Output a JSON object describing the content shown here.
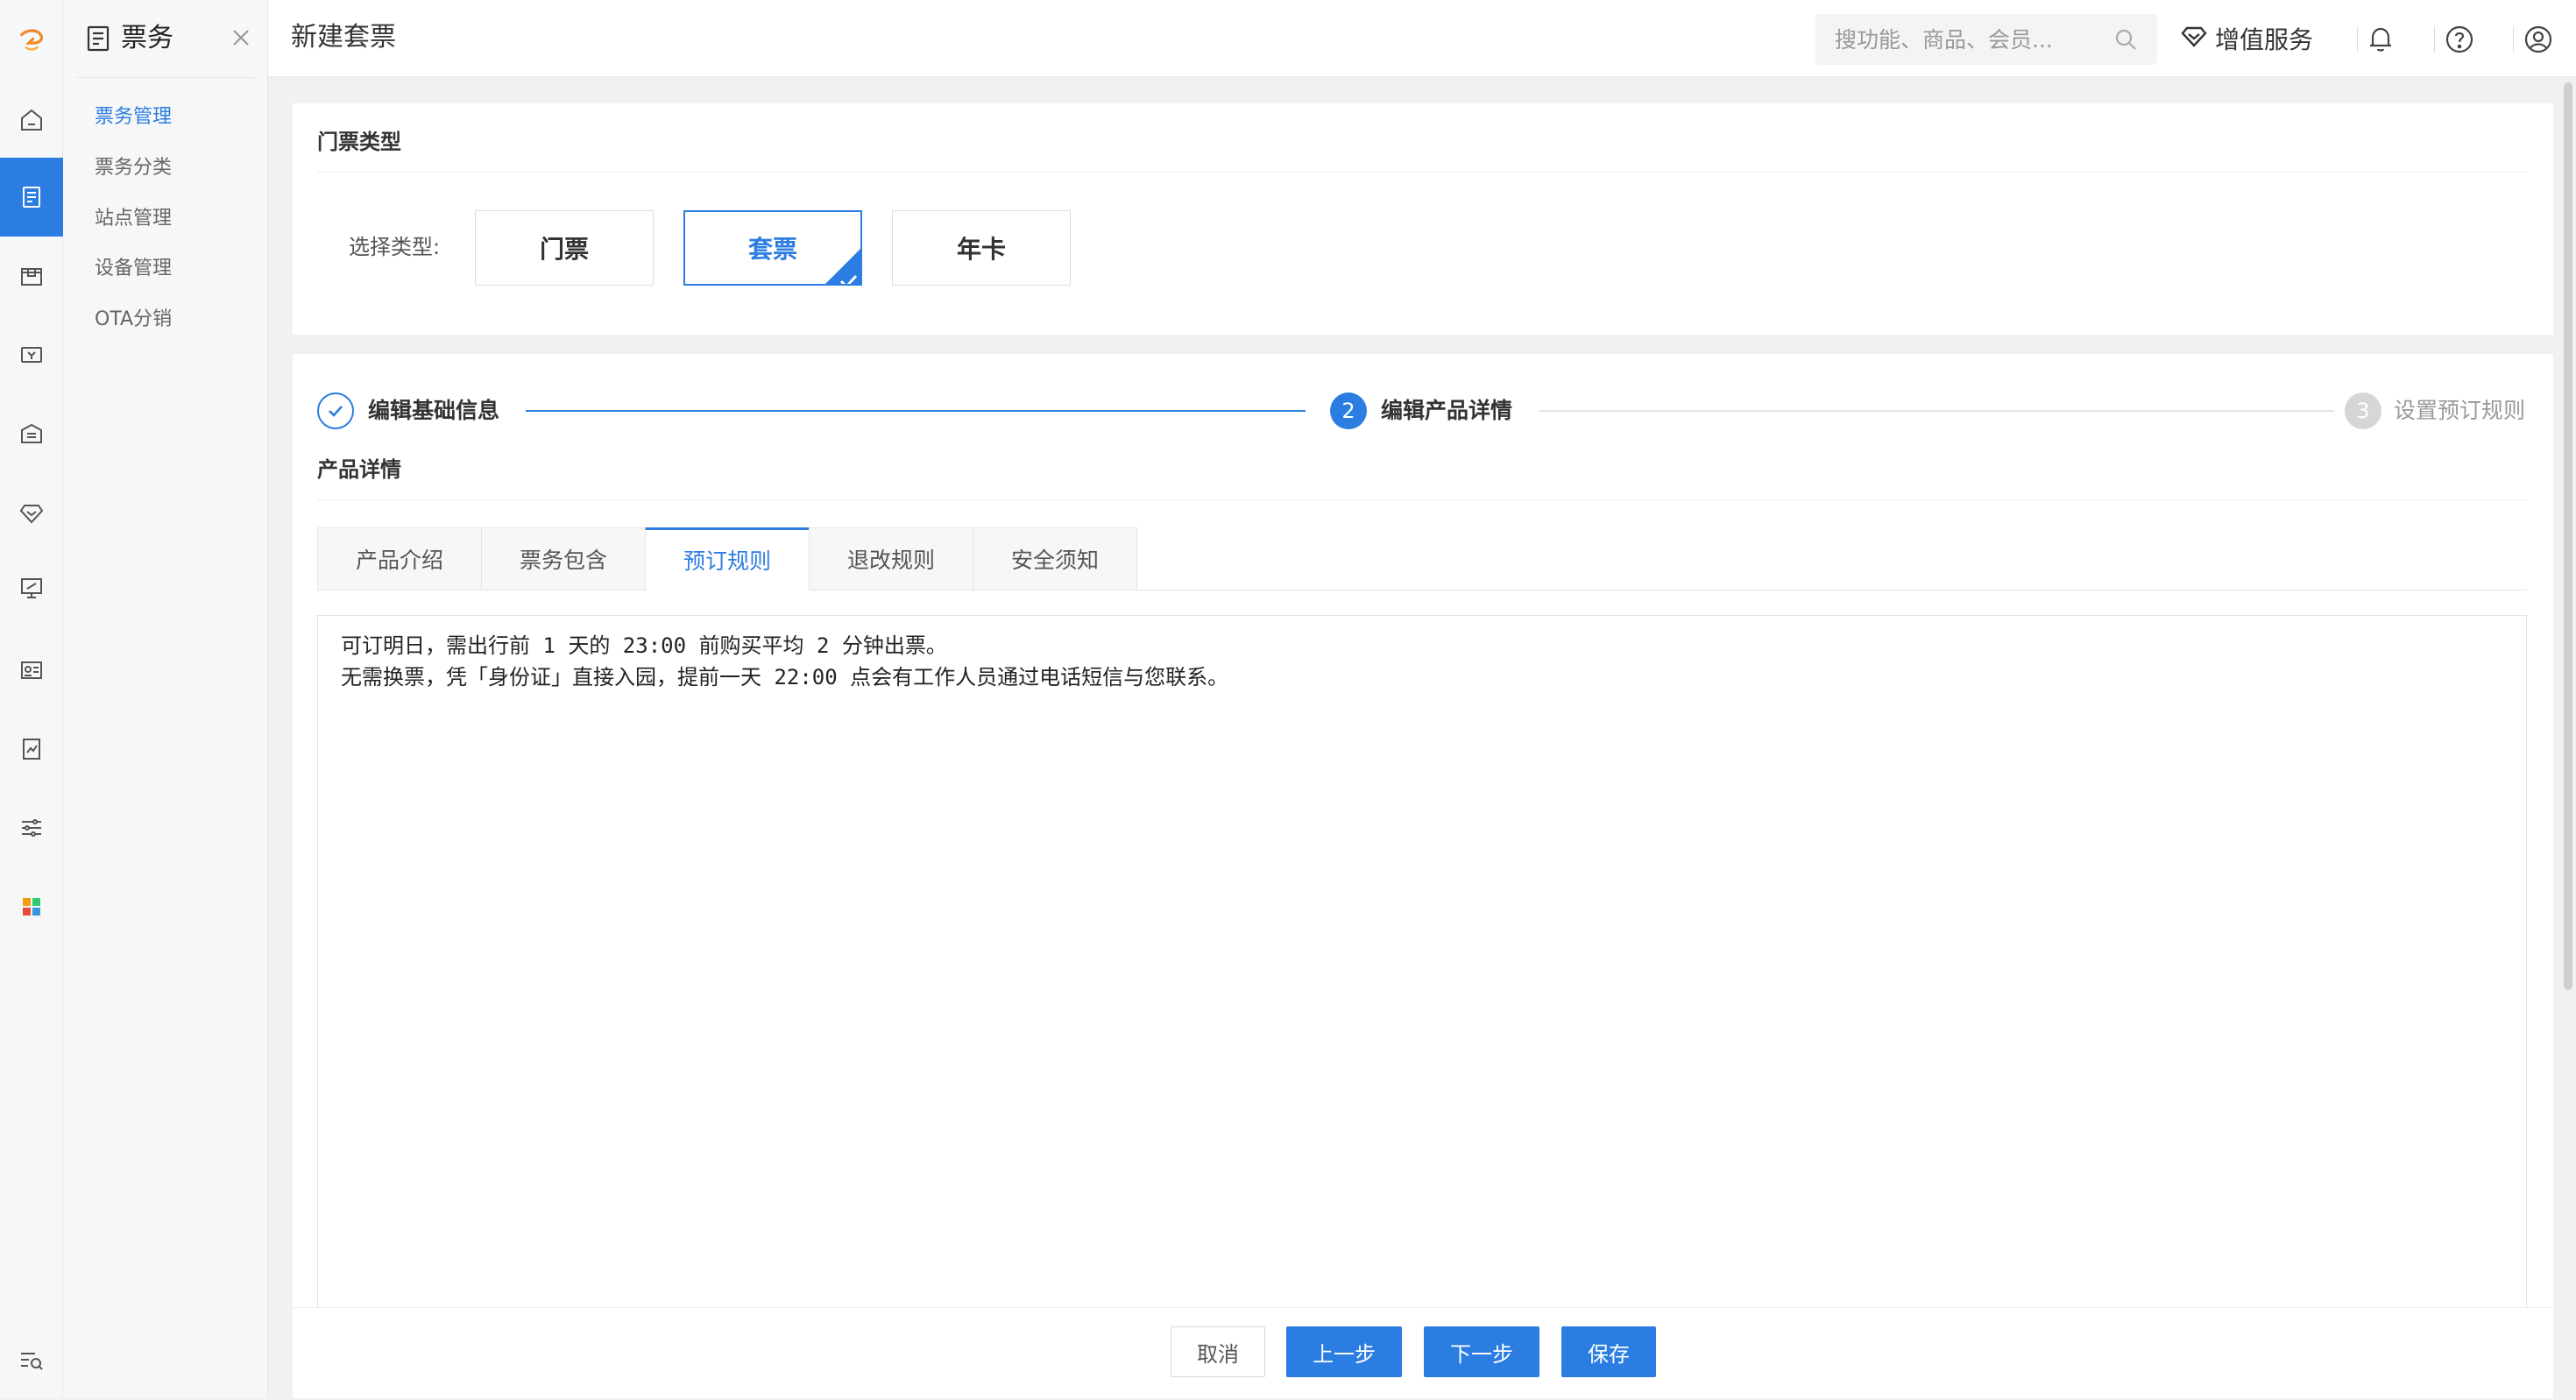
{
  "icons": {
    "logo": "brand-logo",
    "rail": [
      "home-icon",
      "ticket-icon",
      "shop-icon",
      "money-icon",
      "hotel-icon",
      "diamond-icon",
      "monitor-icon",
      "id-card-icon",
      "report-icon",
      "settings-sliders-icon",
      "apps-grid-icon",
      "search-list-icon"
    ]
  },
  "colors": {
    "accent": "#2b7de1",
    "railActive": "#2b7de1"
  },
  "submenu": {
    "title": "票务",
    "items": [
      {
        "label": "票务管理",
        "active": true
      },
      {
        "label": "票务分类",
        "active": false
      },
      {
        "label": "站点管理",
        "active": false
      },
      {
        "label": "设备管理",
        "active": false
      },
      {
        "label": "OTA分销",
        "active": false
      }
    ]
  },
  "header": {
    "page_title": "新建套票",
    "search_placeholder": "搜功能、商品、会员...",
    "value_added_label": "增值服务"
  },
  "ticket_type": {
    "section_title": "门票类型",
    "select_label": "选择类型:",
    "options": [
      {
        "label": "门票",
        "selected": false
      },
      {
        "label": "套票",
        "selected": true
      },
      {
        "label": "年卡",
        "selected": false
      }
    ]
  },
  "steps": [
    {
      "number": "",
      "label": "编辑基础信息",
      "state": "done"
    },
    {
      "number": "2",
      "label": "编辑产品详情",
      "state": "current"
    },
    {
      "number": "3",
      "label": "设置预订规则",
      "state": "pending"
    }
  ],
  "product_detail": {
    "section_title": "产品详情",
    "tabs": [
      {
        "label": "产品介绍",
        "active": false
      },
      {
        "label": "票务包含",
        "active": false
      },
      {
        "label": "预订规则",
        "active": true
      },
      {
        "label": "退改规则",
        "active": false
      },
      {
        "label": "安全须知",
        "active": false
      }
    ],
    "content_lines": [
      "可订明日，需出行前 1 天的 23:00 前购买平均 2 分钟出票。",
      "无需换票，凭「身份证」直接入园，提前一天 22:00 点会有工作人员通过电话短信与您联系。"
    ]
  },
  "footer": {
    "cancel_label": "取消",
    "prev_label": "上一步",
    "next_label": "下一步",
    "save_label": "保存"
  }
}
